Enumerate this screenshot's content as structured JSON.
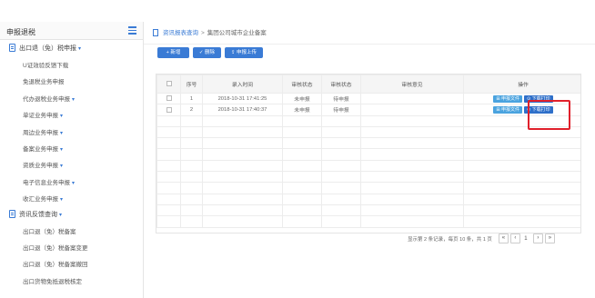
{
  "sidebar": {
    "title": "申报退税",
    "sections": [
      {
        "label": "出口退（免）税申报",
        "items": [
          "出口退（免）税申报",
          "U证效验反馈下载",
          "免退税业务申报",
          "代办退税业务申报",
          "单证业务申报",
          "周边业务申报",
          "备案业务申报",
          "资质业务申报",
          "电子信息业务申报",
          "收汇业务申报"
        ]
      },
      {
        "label": "资讯反馈查询",
        "items": [
          "出口退（免）税备案",
          "出口退（免）税备案变更",
          "出口退（免）税备案撤回",
          "出口货物免抵退税核定"
        ]
      }
    ]
  },
  "breadcrumb": {
    "root": "资讯报表查询",
    "sep": ">",
    "current": "集团公司城市企业备案"
  },
  "toolbar": {
    "add_label": "+ 新增",
    "delete_label": "✓ 删除",
    "upload_label": "⇪ 申报上传"
  },
  "table": {
    "headers": [
      "",
      "序号",
      "录入时间",
      "审核状态",
      "审核状态",
      "审核意见",
      "操作"
    ],
    "rows": [
      {
        "index": "1",
        "time": "2018-10-31 17:41:25",
        "status1": "未申报",
        "status2": "待申报",
        "opinion": "",
        "view": "⊞ 申报文件",
        "download": "⊙ 下载打印"
      },
      {
        "index": "2",
        "time": "2018-10-31 17:40:37",
        "status1": "未申报",
        "status2": "待申报",
        "opinion": "",
        "view": "⊞ 申报文件",
        "download": "⊙ 下载打印"
      }
    ],
    "empty_rows": 10
  },
  "pager": {
    "info": "显示第 2 条记录，每页 10 条，共 1 页",
    "first": "«",
    "prev": "‹",
    "page": "1",
    "next": "›",
    "last": "»"
  },
  "colors": {
    "accent": "#3a7bd5",
    "highlight": "#e0202b"
  }
}
